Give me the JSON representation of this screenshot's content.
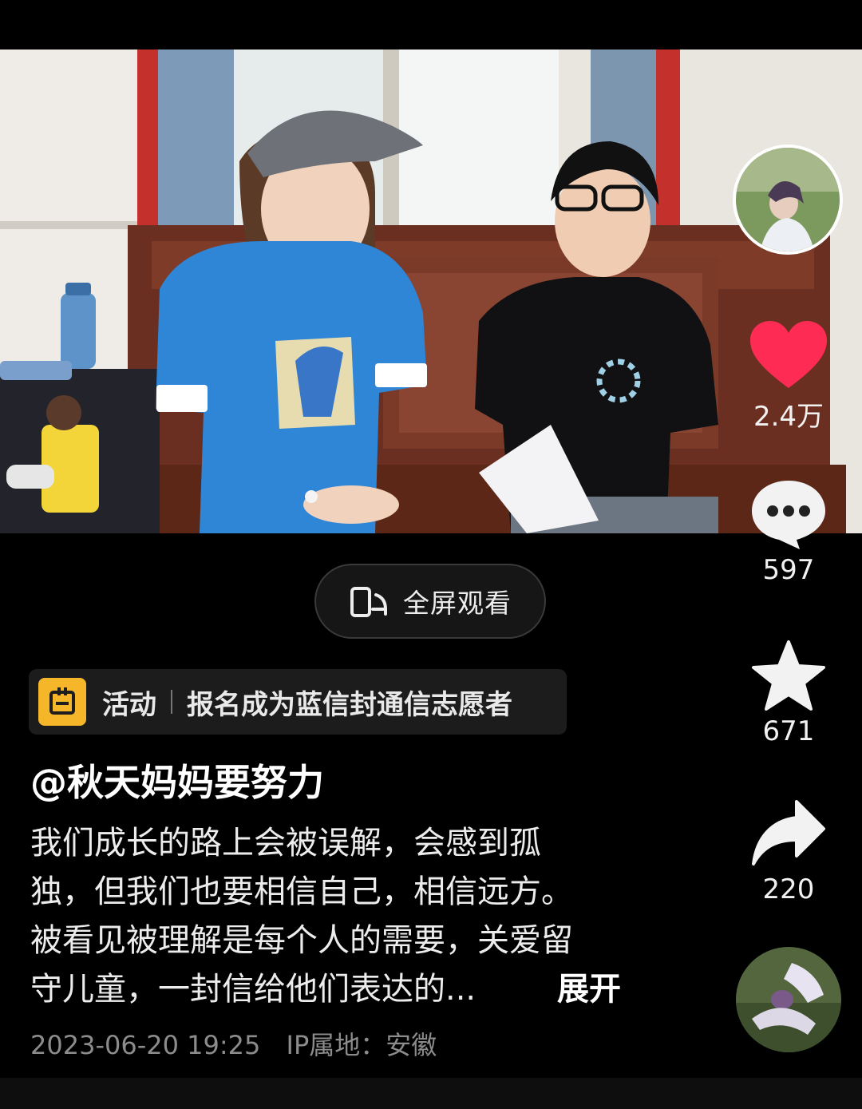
{
  "fullscreen": {
    "label": "全屏观看",
    "icon": "fullscreen-rotate-icon"
  },
  "activity": {
    "icon": "activity-calendar-icon",
    "tag": "活动",
    "title": "报名成为蓝信封通信志愿者"
  },
  "post": {
    "author": "@秋天妈妈要努力",
    "caption_lines": [
      "我们成长的路上会被误解，会感到孤",
      "独，但我们也要相信自己，相信远方。",
      "被看见被理解是每个人的需要，关爱留",
      "守儿童，一封信给他们表达的..."
    ],
    "expand_label": "展开",
    "date": "2023-06-20 19:25",
    "ip_label": "IP属地：安徽"
  },
  "actions": {
    "like": {
      "count": "2.4万",
      "icon": "heart-icon"
    },
    "comment": {
      "count": "597",
      "icon": "comment-bubble-icon"
    },
    "favorite": {
      "count": "671",
      "icon": "star-icon"
    },
    "share": {
      "count": "220",
      "icon": "share-arrow-icon"
    }
  },
  "colors": {
    "like": "#fe2c55",
    "activity_badge": "#f6b62a",
    "shirt_blue": "#2f86d6"
  }
}
